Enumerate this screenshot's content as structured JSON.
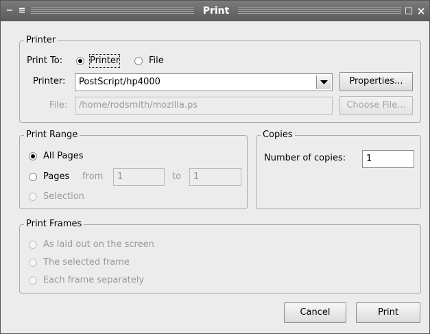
{
  "window": {
    "title": "Print",
    "minimize_glyph": "−",
    "shade_glyph": "≡",
    "maximize_glyph": "□",
    "close_glyph": "×"
  },
  "printer_group": {
    "legend": "Printer",
    "print_to_label": "Print To:",
    "print_to_options": [
      {
        "label": "Printer",
        "selected": true
      },
      {
        "label": "File",
        "selected": false
      }
    ],
    "printer_label": "Printer:",
    "printer_value": "PostScript/hp4000",
    "properties_button": "Properties...",
    "file_label": "File:",
    "file_value": "/home/rodsmith/mozilla.ps",
    "choose_file_button": "Choose File..."
  },
  "range_group": {
    "legend": "Print Range",
    "all_pages": "All Pages",
    "pages": "Pages",
    "from_label": "from",
    "from_value": "1",
    "to_label": "to",
    "to_value": "1",
    "selection": "Selection",
    "selected_option": "all_pages"
  },
  "copies_group": {
    "legend": "Copies",
    "number_label": "Number of copies:",
    "number_value": "1"
  },
  "frames_group": {
    "legend": "Print Frames",
    "options": [
      "As laid out on the screen",
      "The selected frame",
      "Each frame separately"
    ]
  },
  "actions": {
    "cancel": "Cancel",
    "print": "Print"
  }
}
